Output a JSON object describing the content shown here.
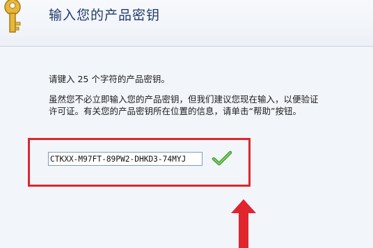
{
  "header": {
    "title": "输入您的产品密钥",
    "icon": "key-icon"
  },
  "content": {
    "instruction": "请键入 25 个字符的产品密钥。",
    "description_line1": "虽然您不必立即输入您的产品密钥，但我们建议您现在输入，以便验证",
    "description_line2": "许可证。有关您的产品密钥所在位置的信息，请单击“帮助”按钮。"
  },
  "product_key": {
    "value": "CTKXX-M97FT-89PW2-DHKD3-74MYJ",
    "valid_icon": "checkmark-icon"
  },
  "annotation": {
    "highlight_color": "#e0252d",
    "arrow_icon": "arrow-up-icon"
  }
}
